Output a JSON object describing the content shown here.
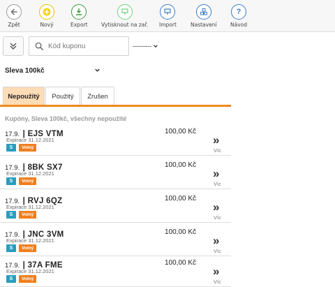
{
  "toolbar": {
    "items": [
      {
        "label": "Zpět",
        "icon": "back-arrow-icon",
        "color": "#9a9a9a"
      },
      {
        "label": "Nový",
        "icon": "plus-icon",
        "color": "#e6c200"
      },
      {
        "label": "Export",
        "icon": "export-icon",
        "color": "#3a9a3a"
      },
      {
        "label": "Vytisknout na zař.",
        "icon": "print-icon",
        "color": "#6bd07a"
      },
      {
        "label": "Import",
        "icon": "import-icon",
        "color": "#3a7cc4"
      },
      {
        "label": "Nastavení",
        "icon": "settings-icon",
        "color": "#3a7cc4"
      },
      {
        "label": "Návod",
        "icon": "help-icon",
        "color": "#3a7cc4"
      }
    ]
  },
  "filters": {
    "search_placeholder": "Kód kuponu",
    "dash_select_value": "---------",
    "coupon_type_value": "Sleva 100kč"
  },
  "tabs": [
    {
      "label": "Nepoužitý",
      "active": true
    },
    {
      "label": "Použitý",
      "active": false
    },
    {
      "label": "Zrušen",
      "active": false
    }
  ],
  "list": {
    "header": "Kupóny, Sleva 100kč, všechny nepoužité",
    "more_label": "Víc",
    "badge_s": "S",
    "badge_status": "Volný",
    "rows": [
      {
        "date": "17.9.",
        "code": "| EJS VTM",
        "expiry": "Expirace 31.12.2021",
        "amount": "100,00 Kč"
      },
      {
        "date": "17.9.",
        "code": "| 8BK SX7",
        "expiry": "Expirace 31.12.2021",
        "amount": "100,00 Kč"
      },
      {
        "date": "17.9.",
        "code": "| RVJ 6QZ",
        "expiry": "Expirace 31.12.2021",
        "amount": "100,00 Kč"
      },
      {
        "date": "17.9.",
        "code": "| JNC 3VM",
        "expiry": "Expirace 31.12.2021",
        "amount": "100,00 Kč"
      },
      {
        "date": "17.9.",
        "code": "| 37A FME",
        "expiry": "Expirace 31.12.2021",
        "amount": "100,00 Kč"
      }
    ]
  },
  "colors": {
    "accent": "#f08a1e",
    "active_tab_bg": "#fddcb6",
    "badge_s": "#2a9dbd",
    "badge_status": "#f07e1b"
  }
}
